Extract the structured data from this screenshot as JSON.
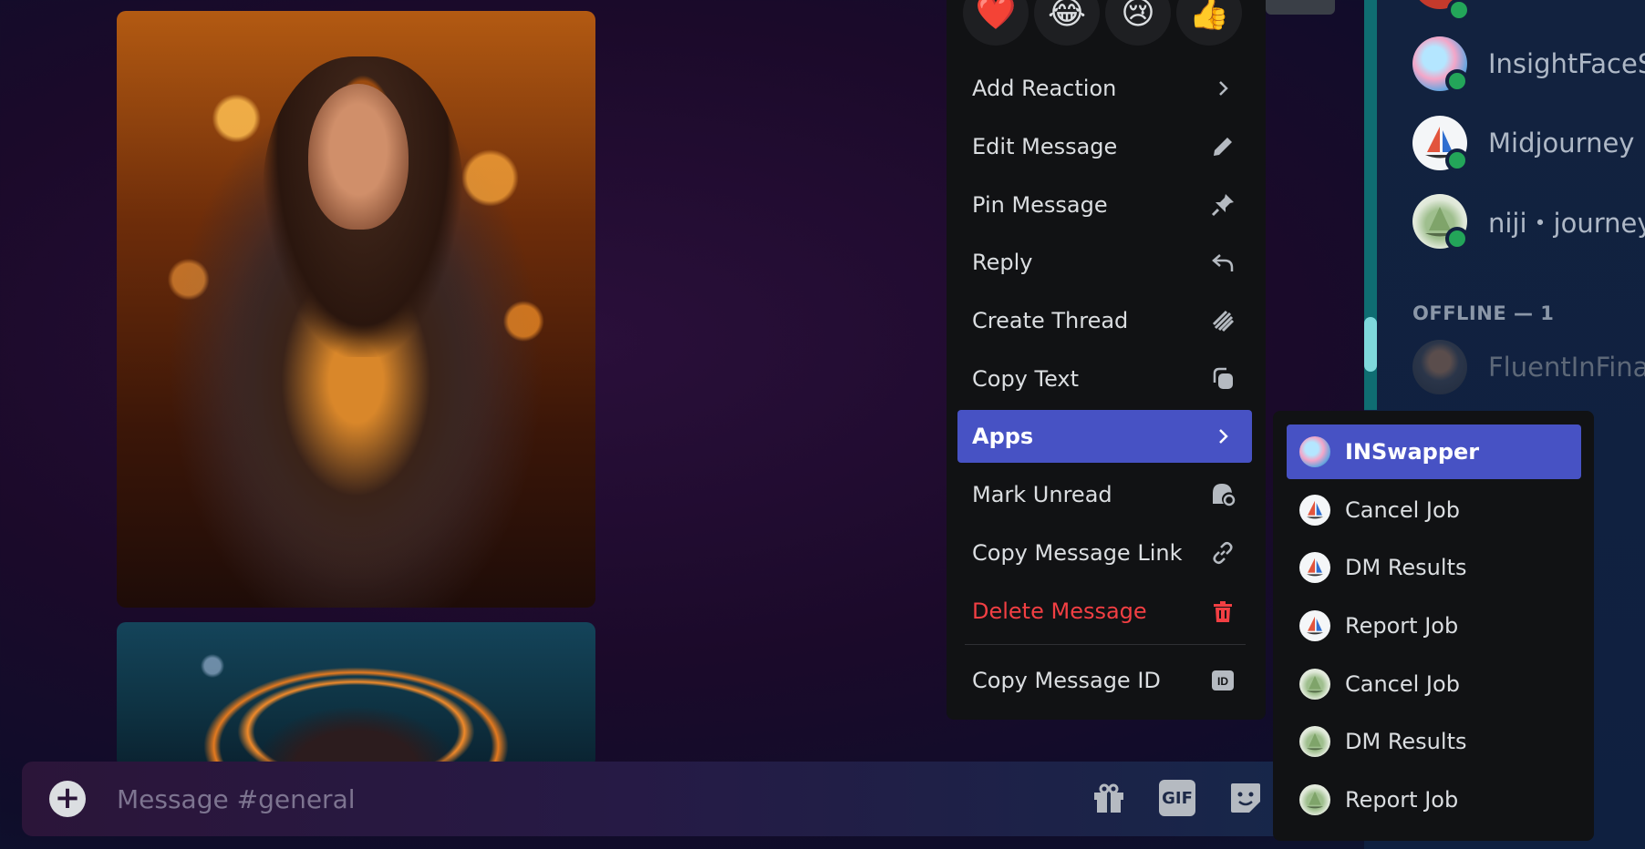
{
  "reactions": [
    {
      "name": "heart",
      "glyph": "❤️"
    },
    {
      "name": "joy",
      "glyph": "😂"
    },
    {
      "name": "cry",
      "glyph": "😢"
    },
    {
      "name": "thumbs-up",
      "glyph": "👍"
    }
  ],
  "context_menu": {
    "items": [
      {
        "label": "Add Reaction",
        "icon": "chevron-right-icon"
      },
      {
        "label": "Edit Message",
        "icon": "pencil-icon"
      },
      {
        "label": "Pin Message",
        "icon": "pin-icon"
      },
      {
        "label": "Reply",
        "icon": "reply-icon"
      },
      {
        "label": "Create Thread",
        "icon": "thread-icon"
      },
      {
        "label": "Copy Text",
        "icon": "copy-icon"
      },
      {
        "label": "Apps",
        "icon": "chevron-right-icon",
        "active": true
      },
      {
        "label": "Mark Unread",
        "icon": "mark-unread-icon"
      },
      {
        "label": "Copy Message Link",
        "icon": "link-icon"
      },
      {
        "label": "Delete Message",
        "icon": "trash-icon",
        "danger": true
      },
      {
        "label": "Copy Message ID",
        "icon": "id-icon"
      }
    ]
  },
  "apps_submenu": {
    "items": [
      {
        "label": "INSwapper",
        "app": "insightface",
        "active": true
      },
      {
        "label": "Cancel Job",
        "app": "midjourney"
      },
      {
        "label": "DM Results",
        "app": "midjourney"
      },
      {
        "label": "Report Job",
        "app": "midjourney"
      },
      {
        "label": "Cancel Job",
        "app": "niji"
      },
      {
        "label": "DM Results",
        "app": "niji"
      },
      {
        "label": "Report Job",
        "app": "niji"
      }
    ]
  },
  "members": {
    "online": [
      {
        "name": "InsightFaceSw",
        "avatar": "insightface"
      },
      {
        "name": "Midjourney B",
        "avatar": "midjourney"
      },
      {
        "name": "niji・journey",
        "avatar": "niji"
      }
    ],
    "offline_header": "OFFLINE — 1",
    "offline": [
      {
        "name": "FluentInFinan",
        "avatar": "user-photo"
      }
    ]
  },
  "composer": {
    "placeholder": "Message #general",
    "gif_label": "GIF"
  },
  "colors": {
    "accent": "#4752c4",
    "danger": "#f23f43",
    "online": "#23a559",
    "menu_bg": "#111214"
  }
}
